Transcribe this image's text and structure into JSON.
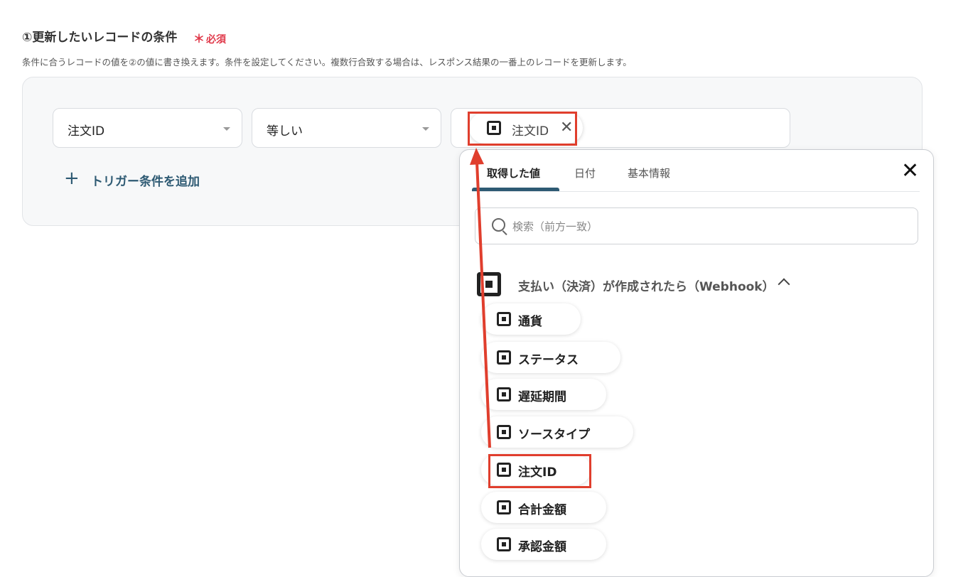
{
  "section": {
    "title": "①更新したいレコードの条件",
    "required": "必須",
    "description": "条件に合うレコードの値を②の値に書き換えます。条件を設定してください。複数行合致する場合は、レスポンス結果の一番上のレコードを更新します。"
  },
  "condition": {
    "field": "注文ID",
    "operator": "等しい",
    "value_chip": "注文ID",
    "value_chip_close": "✕",
    "add_trigger": "トリガー条件を追加",
    "add_plus": "+"
  },
  "popup": {
    "tabs": [
      "取得した値",
      "日付",
      "基本情報"
    ],
    "close": "✕",
    "search_placeholder": "検索（前方一致）",
    "group_title": "支払い（決済）が作成されたら（Webhook）",
    "items": [
      "通貨",
      "ステータス",
      "遅延期間",
      "ソースタイプ",
      "注文ID",
      "合計金額",
      "承認金額"
    ]
  },
  "colors": {
    "accent": "#2e5a73",
    "required": "#e0394a",
    "highlight": "#e03e2d"
  }
}
